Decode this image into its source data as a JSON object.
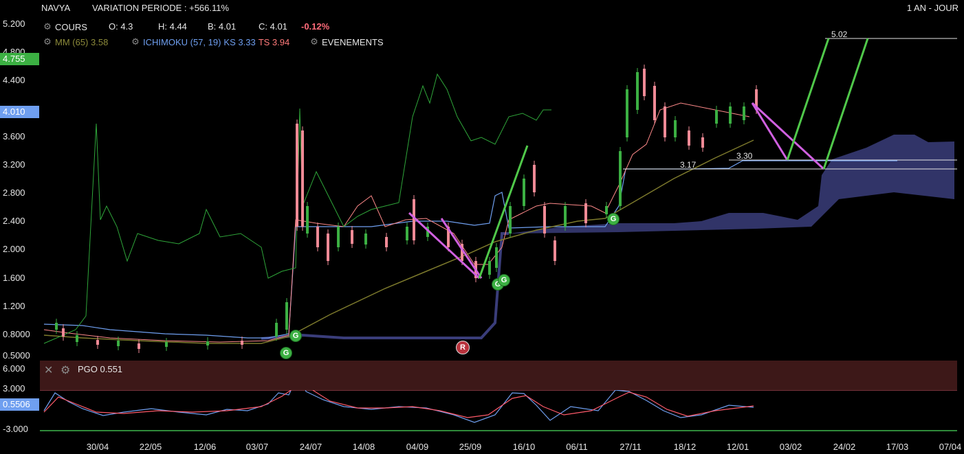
{
  "header": {
    "ticker": "NAVYA",
    "variation": "VARIATION PERIODE : +566.11%",
    "period": "1 AN - JOUR"
  },
  "legend": {
    "cours_label": "COURS",
    "open": "O: 4.3",
    "high": "H: 4.44",
    "low": "B: 4.01",
    "close": "C: 4.01",
    "change": "-0.12%",
    "mm": "MM (65) 3.58",
    "ichimoku": "ICHIMOKU (57, 19)",
    "ks": "KS 3.33",
    "ts": "TS 3.94",
    "events": "EVENEMENTS"
  },
  "y_axis": [
    "5.200",
    "4.800",
    "4.400",
    "3.600",
    "3.200",
    "2.800",
    "2.400",
    "2.000",
    "1.600",
    "1.200",
    "0.8000",
    "0.5000"
  ],
  "y_tags": {
    "high": "4.755",
    "last": "4.010"
  },
  "x_axis": [
    "30/04",
    "22/05",
    "12/06",
    "03/07",
    "24/07",
    "14/08",
    "04/09",
    "25/09",
    "16/10",
    "06/11",
    "27/11",
    "18/12",
    "12/01",
    "03/02",
    "24/02",
    "17/03",
    "07/04"
  ],
  "levels": {
    "top": "5.02",
    "mid": "3.30",
    "low": "3.17"
  },
  "pgo": {
    "label": "PGO 0.551",
    "axis": [
      "6.000",
      "3.000",
      "-3.000"
    ],
    "tag": "0.5506"
  },
  "markers": {
    "g": "G",
    "r": "R"
  },
  "colors": {
    "up": "#3cb043",
    "down": "#f08a96",
    "mm": "#7d7a2c",
    "ichimoku": "#6f9ff0",
    "cloud": "#3a3d7a",
    "volume": "#2fa63a",
    "trend_green": "#50c84a",
    "trend_magenta": "#d060e0"
  },
  "chart_data": {
    "type": "line",
    "y_range": [
      0.5,
      5.2
    ],
    "series": [
      {
        "name": "MM (65)",
        "values": [
          0.78,
          0.76,
          0.74,
          0.72,
          0.72,
          0.73,
          0.8,
          1.1,
          1.5,
          1.8,
          2.0,
          2.2,
          2.4,
          2.5,
          2.7,
          3.0,
          3.3,
          3.58
        ]
      },
      {
        "name": "KS",
        "values": [
          0.95,
          0.9,
          0.8,
          0.75,
          0.72,
          0.75,
          2.3,
          2.3,
          2.3,
          2.4,
          1.65,
          2.3,
          2.3,
          3.17,
          3.17,
          3.17,
          3.3,
          3.33
        ]
      }
    ]
  }
}
